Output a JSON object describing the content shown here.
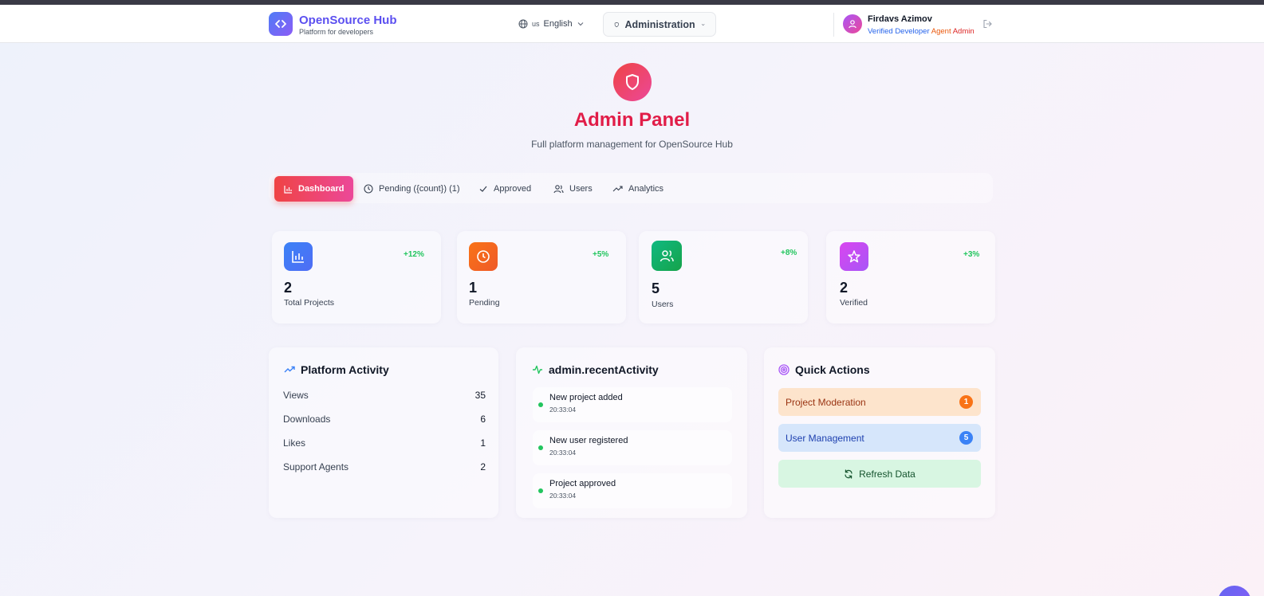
{
  "brand": {
    "name": "OpenSource Hub",
    "tagline": "Platform for developers"
  },
  "header": {
    "language_flag": "us",
    "language": "English",
    "mode_select": "Administration",
    "user": {
      "name": "Firdavs Azimov",
      "roles": [
        "Verified Developer",
        "Agent",
        "Admin"
      ]
    }
  },
  "hero": {
    "title": "Admin Panel",
    "subtitle": "Full platform management for OpenSource Hub"
  },
  "tabs": [
    {
      "label": "Dashboard",
      "icon": "bar-chart-icon",
      "active": true
    },
    {
      "label": "Pending ({count}) (1)",
      "icon": "clock-icon",
      "active": false
    },
    {
      "label": "Approved",
      "icon": "check-icon",
      "active": false
    },
    {
      "label": "Users",
      "icon": "users-icon",
      "active": false
    },
    {
      "label": "Analytics",
      "icon": "trending-up-icon",
      "active": false
    }
  ],
  "stats": [
    {
      "value": "2",
      "label": "Total Projects",
      "change": "+12%",
      "icon": "bar-chart-icon",
      "color": "#3b82f6"
    },
    {
      "value": "1",
      "label": "Pending",
      "change": "+5%",
      "icon": "clock-icon",
      "color": "#f97316"
    },
    {
      "value": "5",
      "label": "Users",
      "change": "+8%",
      "icon": "users-icon",
      "color": "#10b981"
    },
    {
      "value": "2",
      "label": "Verified",
      "change": "+3%",
      "icon": "star-icon",
      "color": "#d946ef"
    }
  ],
  "platform_activity": {
    "title": "Platform Activity",
    "rows": [
      {
        "label": "Views",
        "value": "35"
      },
      {
        "label": "Downloads",
        "value": "6"
      },
      {
        "label": "Likes",
        "value": "1"
      },
      {
        "label": "Support Agents",
        "value": "2"
      }
    ]
  },
  "recent_activity": {
    "title": "admin.recentActivity",
    "items": [
      {
        "text": "New project added",
        "time": "20:33:04"
      },
      {
        "text": "New user registered",
        "time": "20:33:04"
      },
      {
        "text": "Project approved",
        "time": "20:33:04"
      }
    ]
  },
  "quick_actions": {
    "title": "Quick Actions",
    "buttons": [
      {
        "label": "Project Moderation",
        "badge": "1"
      },
      {
        "label": "User Management",
        "badge": "5"
      },
      {
        "label": "Refresh Data"
      }
    ]
  },
  "colors": {
    "accent": "#5b4ff0",
    "admin_red": "#e11d48",
    "positive": "#22c55e"
  }
}
